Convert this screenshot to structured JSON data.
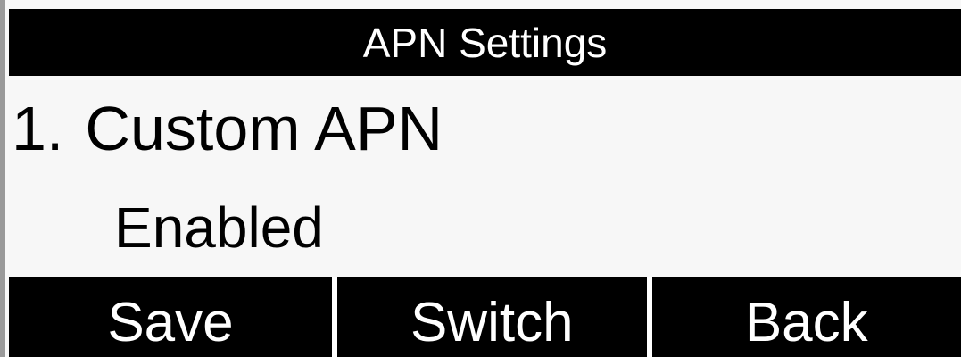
{
  "title_bar": {
    "title": "APN Settings"
  },
  "menu": {
    "items": [
      {
        "number": "1.",
        "label": "Custom APN",
        "value": "Enabled"
      }
    ]
  },
  "softkeys": [
    {
      "label": "Save"
    },
    {
      "label": "Switch"
    },
    {
      "label": "Back"
    }
  ],
  "colors": {
    "bar_background": "#000000",
    "bar_text": "#ffffff",
    "content_background": "#f7f7f7",
    "content_text": "#000000"
  }
}
